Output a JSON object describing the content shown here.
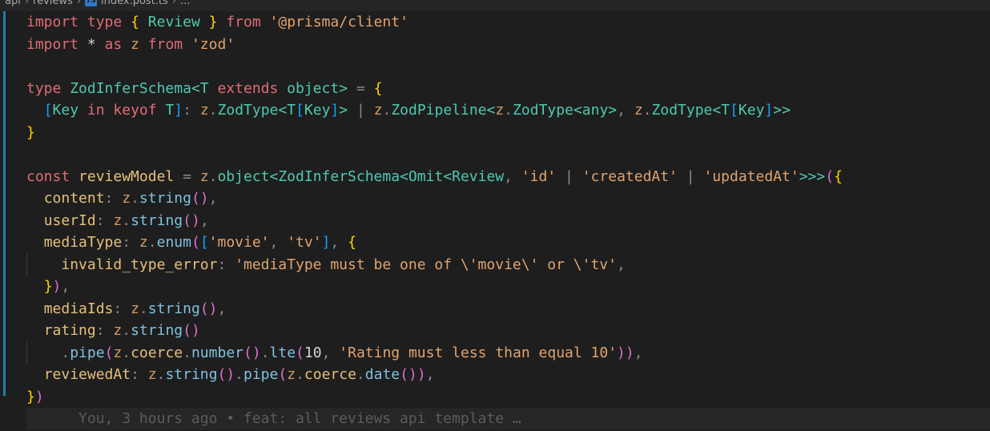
{
  "breadcrumb": {
    "items": [
      "api",
      "reviews",
      "index.post.ts",
      "..."
    ],
    "file_icon": "TS"
  },
  "code_lines": [
    "import type { Review } from '@prisma/client'",
    "import * as z from 'zod'",
    "",
    "type ZodInferSchema<T extends object> = {",
    "  [Key in keyof T]: z.ZodType<T[Key]> | z.ZodPipeline<z.ZodType<any>, z.ZodType<T[Key]>>",
    "}",
    "",
    "const reviewModel = z.object<ZodInferSchema<Omit<Review, 'id' | 'createdAt' | 'updatedAt'>>>({",
    "  content: z.string(),",
    "  userId: z.string(),",
    "  mediaType: z.enum(['movie', 'tv'], {",
    "    invalid_type_error: 'mediaType must be one of \\'movie\\' or \\'tv',",
    "  }),",
    "  mediaIds: z.string(),",
    "  rating: z.string()",
    "    .pipe(z.coerce.number().lte(10, 'Rating must less than equal 10')),",
    "  reviewedAt: z.string().pipe(z.coerce.date()),",
    "})"
  ],
  "blame": "You, 3 hours ago • feat: all reviews api template …",
  "colors": {
    "background": "#1e1e1e",
    "git_gutter": "#1b81a8",
    "keyword": "#e06c75",
    "type": "#4ec9b0",
    "string": "#e2a36d"
  }
}
